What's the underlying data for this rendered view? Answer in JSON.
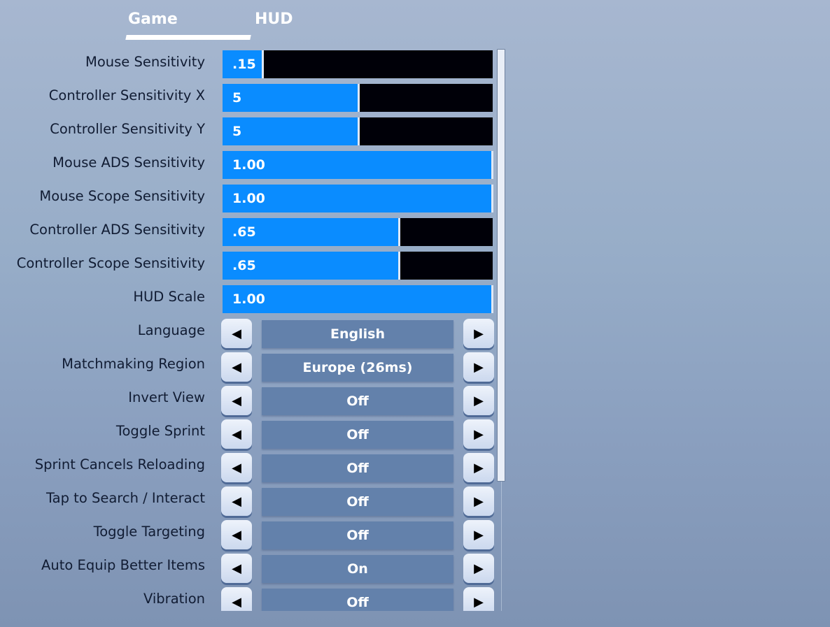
{
  "tabs": [
    {
      "label": "Game",
      "active": true
    },
    {
      "label": "HUD",
      "active": false
    }
  ],
  "colors": {
    "slider_fill": "#0a8cff",
    "slider_empty": "#000008",
    "select_bg": "#6381ab",
    "label_text": "#111c33"
  },
  "sliders": [
    {
      "label": "Mouse Sensitivity",
      "value": ".15",
      "fill_fraction": 0.145
    },
    {
      "label": "Controller Sensitivity X",
      "value": "5",
      "fill_fraction": 0.5
    },
    {
      "label": "Controller Sensitivity Y",
      "value": "5",
      "fill_fraction": 0.5
    },
    {
      "label": "Mouse ADS Sensitivity",
      "value": "1.00",
      "fill_fraction": 1.0
    },
    {
      "label": "Mouse Scope Sensitivity",
      "value": "1.00",
      "fill_fraction": 1.0
    },
    {
      "label": "Controller ADS Sensitivity",
      "value": ".65",
      "fill_fraction": 0.65
    },
    {
      "label": "Controller Scope Sensitivity",
      "value": ".65",
      "fill_fraction": 0.65
    },
    {
      "label": "HUD Scale",
      "value": "1.00",
      "fill_fraction": 1.0
    }
  ],
  "selectors": [
    {
      "label": "Language",
      "value": "English"
    },
    {
      "label": "Matchmaking Region",
      "value": "Europe (26ms)"
    },
    {
      "label": "Invert View",
      "value": "Off"
    },
    {
      "label": "Toggle Sprint",
      "value": "Off"
    },
    {
      "label": "Sprint Cancels Reloading",
      "value": "Off"
    },
    {
      "label": "Tap to Search / Interact",
      "value": "Off"
    },
    {
      "label": "Toggle Targeting",
      "value": "Off"
    },
    {
      "label": "Auto Equip Better Items",
      "value": "On"
    },
    {
      "label": "Vibration",
      "value": "Off"
    }
  ],
  "icons": {
    "left_arrow": "◀",
    "right_arrow": "▶"
  },
  "scroll": {
    "visible_fraction": 0.77,
    "position": 0.0
  }
}
